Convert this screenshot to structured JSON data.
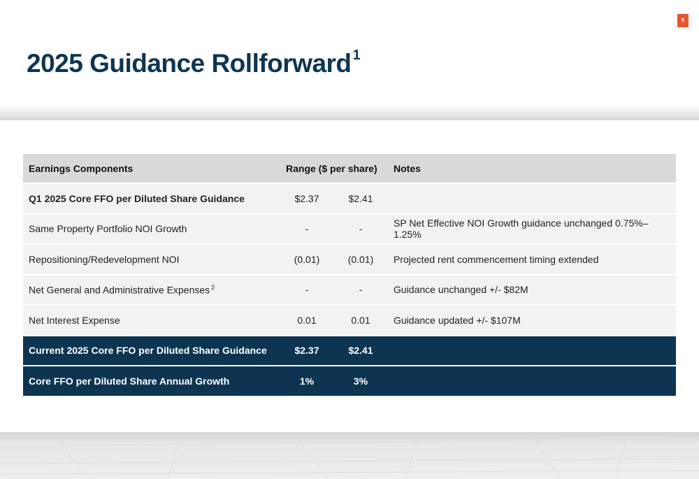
{
  "page_number": "5",
  "title": "2025 Guidance Rollforward",
  "title_footnote": "1",
  "table": {
    "headers": {
      "component": "Earnings Components",
      "range": "Range ($ per share)",
      "notes": "Notes"
    },
    "rows": [
      {
        "component": "Q1 2025 Core FFO per Diluted Share Guidance",
        "low": "$2.37",
        "high": "$2.41",
        "notes": "",
        "style": "bold"
      },
      {
        "component": "Same Property Portfolio NOI Growth",
        "low": "-",
        "high": "-",
        "notes": "SP Net Effective NOI Growth guidance unchanged 0.75%–1.25%",
        "style": "light"
      },
      {
        "component": "Repositioning/Redevelopment NOI",
        "low": "(0.01)",
        "high": "(0.01)",
        "notes": "Projected rent commencement timing extended",
        "style": "light"
      },
      {
        "component": "Net General and Administrative Expenses",
        "footnote": "2",
        "low": "-",
        "high": "-",
        "notes": "Guidance unchanged +/- $82M",
        "style": "light"
      },
      {
        "component": "Net Interest Expense",
        "low": "0.01",
        "high": "0.01",
        "notes": "Guidance updated +/- $107M",
        "style": "light"
      },
      {
        "component": "Current 2025 Core FFO per Diluted Share Guidance",
        "low": "$2.37",
        "high": "$2.41",
        "notes": "",
        "style": "dark"
      },
      {
        "component": "Core FFO per Diluted Share Annual Growth",
        "low": "1%",
        "high": "3%",
        "notes": "",
        "style": "dark"
      }
    ]
  },
  "colors": {
    "title": "#0d3552",
    "dark_row": "#0d3552",
    "light_row": "#f2f2f2",
    "header_row": "#d9d9d9",
    "page_badge": "#e4572e"
  }
}
